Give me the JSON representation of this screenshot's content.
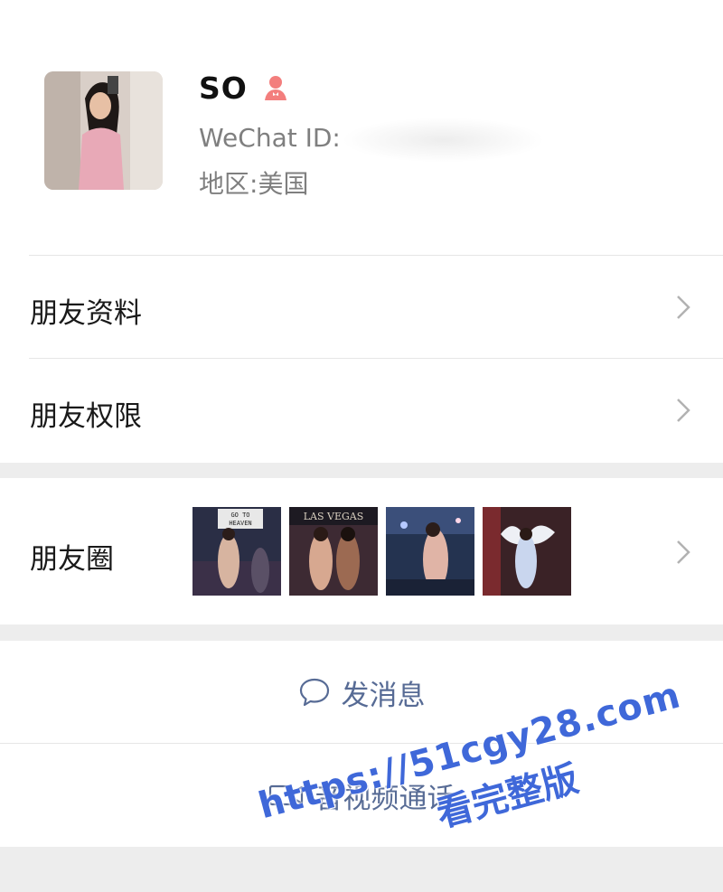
{
  "profile": {
    "name": "SO",
    "gender_icon": "female-icon",
    "wechat_id_label": "WeChat ID:",
    "wechat_id_value": "",
    "region_label": "地区:",
    "region_value": "美国"
  },
  "menu": {
    "friend_profile": "朋友资料",
    "friend_permissions": "朋友权限"
  },
  "moments": {
    "label": "朋友圈",
    "thumb_captions": [
      "GO TO HEAVEN",
      "LAS VEGAS",
      "",
      ""
    ]
  },
  "actions": {
    "send_message": "发消息",
    "video_call": "音视频通话"
  },
  "watermark": {
    "url": "https://51cgy28.com",
    "subtitle": "看完整版"
  },
  "colors": {
    "accent": "#576b95",
    "gender_female": "#f37e7d",
    "background": "#ededed",
    "watermark": "#3f68d9"
  }
}
